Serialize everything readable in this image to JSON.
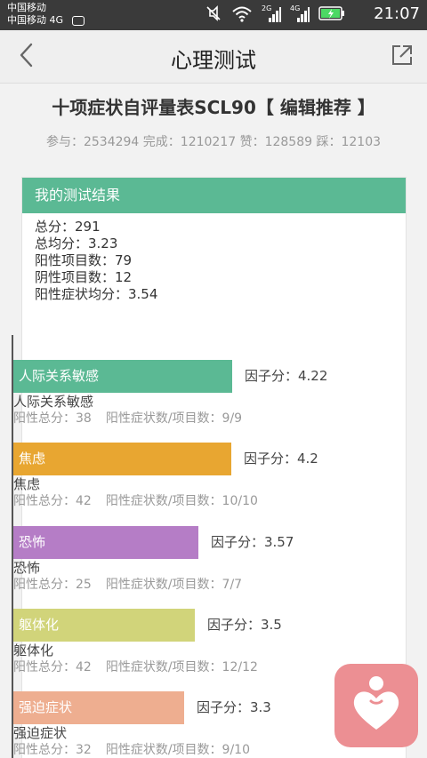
{
  "statusbar": {
    "carrier1": "中国移动",
    "carrier2": "中国移动 4G",
    "net_labels": [
      "2G",
      "4G"
    ],
    "time": "21:07"
  },
  "appbar": {
    "title": "心理测试",
    "back_icon": "chevron-left-icon",
    "share_icon": "share-external-icon"
  },
  "test": {
    "title": "十项症状自评量表SCL90【 编辑推荐 】",
    "stats": "参与：2534294  完成：1210217  赞：128589  踩：12103"
  },
  "result": {
    "header": "我的测试结果",
    "summary": [
      "总分：291",
      "总均分：3.23",
      "阳性项目数：79",
      "阴性项目数：12",
      "阳性症状均分：3.54"
    ]
  },
  "factors": [
    {
      "label": "人际关系敏感",
      "score_text": "因子分：4.22",
      "score": 4.22,
      "color": "#5bb994",
      "name": "人际关系敏感",
      "total": "阳性总分：38",
      "ratio": "阳性症状数/项目数：9/9"
    },
    {
      "label": "焦虑",
      "score_text": "因子分：4.2",
      "score": 4.2,
      "color": "#e8a631",
      "name": "焦虑",
      "total": "阳性总分：42",
      "ratio": "阳性症状数/项目数：10/10"
    },
    {
      "label": "恐怖",
      "score_text": "因子分：3.57",
      "score": 3.57,
      "color": "#b57dc6",
      "name": "恐怖",
      "total": "阳性总分：25",
      "ratio": "阳性症状数/项目数：7/7"
    },
    {
      "label": "躯体化",
      "score_text": "因子分：3.5",
      "score": 3.5,
      "color": "#d1d47a",
      "name": "躯体化",
      "total": "阳性总分：42",
      "ratio": "阳性症状数/项目数：12/12"
    },
    {
      "label": "强迫症状",
      "score_text": "因子分：3.3",
      "score": 3.3,
      "color": "#eeae90",
      "name": "强迫症状",
      "total": "阳性总分：32",
      "ratio": "阳性症状数/项目数：9/10"
    }
  ],
  "fab": {
    "icon": "heart-person-icon",
    "color": "#ec8f93"
  }
}
